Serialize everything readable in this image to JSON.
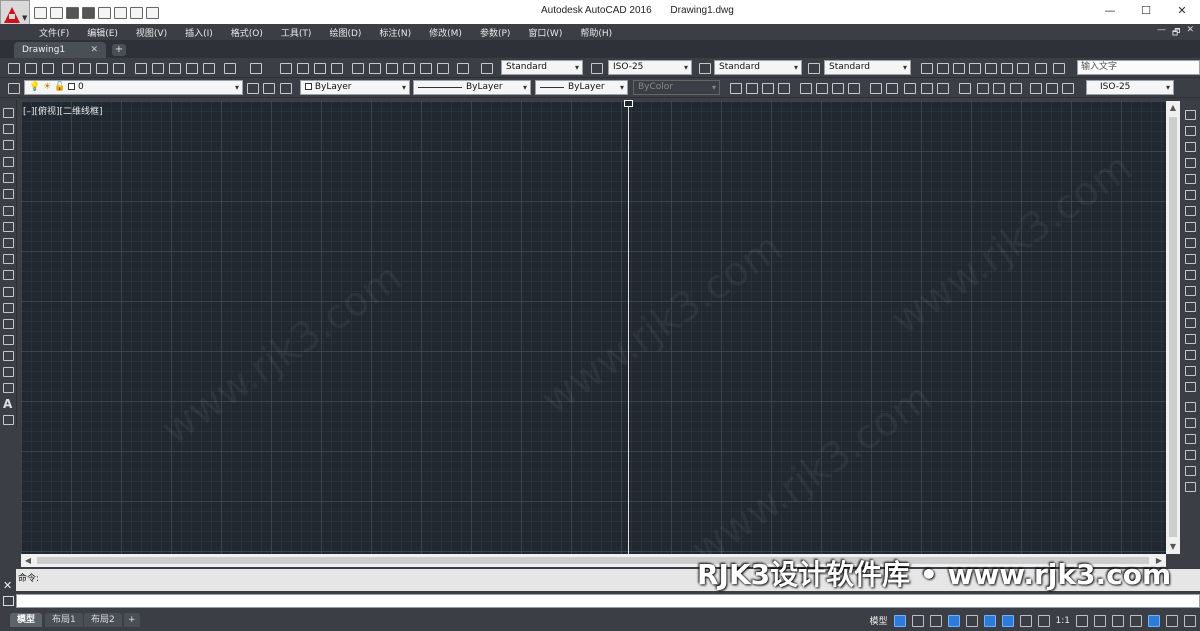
{
  "titlebar": {
    "app_name": "Autodesk AutoCAD 2016",
    "file_name": "Drawing1.dwg",
    "minimize": "—",
    "maximize": "☐",
    "close": "✕"
  },
  "menu": {
    "items": [
      "文件(F)",
      "编辑(E)",
      "视图(V)",
      "插入(I)",
      "格式(O)",
      "工具(T)",
      "绘图(D)",
      "标注(N)",
      "修改(M)",
      "参数(P)",
      "窗口(W)",
      "帮助(H)"
    ],
    "right_controls": [
      "—",
      "🗗",
      "✕"
    ]
  },
  "tabs": {
    "doc_tab": "Drawing1",
    "close": "✕",
    "new": "+"
  },
  "toolbar1": {
    "text_style": "Standard",
    "dim_style": "ISO-25",
    "table_style": "Standard",
    "mleader_style": "Standard",
    "text_input_placeholder": "输入文字"
  },
  "toolbar2": {
    "layer": "0",
    "color": "ByLayer",
    "linetype": "ByLayer",
    "lineweight": "ByLayer",
    "plotstyle": "ByColor",
    "dim_style": "ISO-25"
  },
  "viewport": {
    "label": "[–][俯视][二维线框]"
  },
  "command": {
    "history": "命令:",
    "input": ""
  },
  "layouts": [
    "模型",
    "布局1",
    "布局2"
  ],
  "layout_new": "+",
  "status": {
    "model_label": "模型",
    "scale": "1:1"
  },
  "watermark": "RJK3设计软件库 • www.rjk3.com",
  "colors": {
    "canvas_bg": "#212830",
    "chrome_bg": "#3b3f45",
    "brand_red": "#d0101a"
  }
}
